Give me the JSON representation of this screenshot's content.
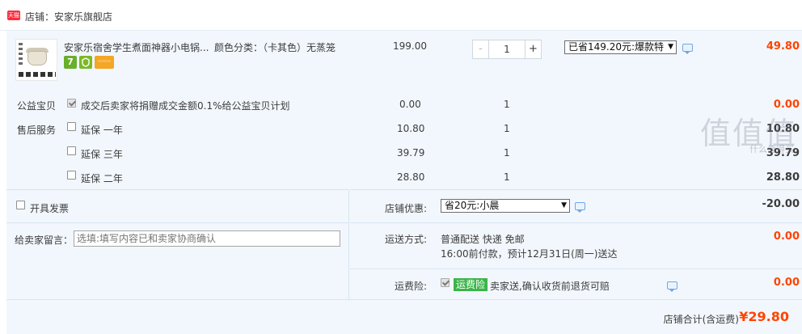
{
  "shop": {
    "name": "店铺：安家乐旗舰店",
    "badge_text": "天猫"
  },
  "product": {
    "title": "安家乐宿舍学生煮面神器小电锅...",
    "spec": "颜色分类：（卡其色）无蒸笼",
    "price": "199.00",
    "quantity": "1",
    "qty_minus": "-",
    "qty_plus": "+",
    "promo_selected": "已省149.20元:爆款特",
    "subtotal": "49.80",
    "badge_days": "7"
  },
  "charity": {
    "label": "公益宝贝",
    "text": "成交后卖家将捐赠成交金额0.1%给公益宝贝计划",
    "price": "0.00",
    "qty": "1",
    "amount": "0.00",
    "checked": true
  },
  "after_sales": {
    "label": "售后服务",
    "options": [
      {
        "text": "延保 一年",
        "price": "10.80",
        "qty": "1",
        "amount": "10.80",
        "checked": false
      },
      {
        "text": "延保 三年",
        "price": "39.79",
        "qty": "1",
        "amount": "39.79",
        "checked": false
      },
      {
        "text": "延保 二年",
        "price": "28.80",
        "qty": "1",
        "amount": "28.80",
        "checked": false
      }
    ]
  },
  "invoice": {
    "label": "开具发票",
    "checked": false
  },
  "message": {
    "label": "给卖家留言：",
    "placeholder": "选填:填写内容已和卖家协商确认"
  },
  "discount": {
    "label": "店铺优惠:",
    "selected": "省20元:小晨",
    "amount": "-20.00"
  },
  "shipping": {
    "label": "运送方式:",
    "method": "普通配送 快递 免邮",
    "note": "16:00前付款，预计12月31日(周一)送达",
    "amount": "0.00"
  },
  "insurance": {
    "label": "运费险:",
    "tag": "运费险",
    "text": "卖家送,确认收货前退货可赔",
    "amount": "0.00",
    "checked": true
  },
  "total": {
    "label": "店铺合计(含运费)",
    "value": "¥29.80"
  },
  "watermark": {
    "text": "值值值",
    "sub": "什么值得买"
  },
  "colors": {
    "accent_red": "#ff4400",
    "panel_bg": "#f2f7fd",
    "tmall_red": "#ff2b3c",
    "insurance_green": "#3bb54a"
  }
}
